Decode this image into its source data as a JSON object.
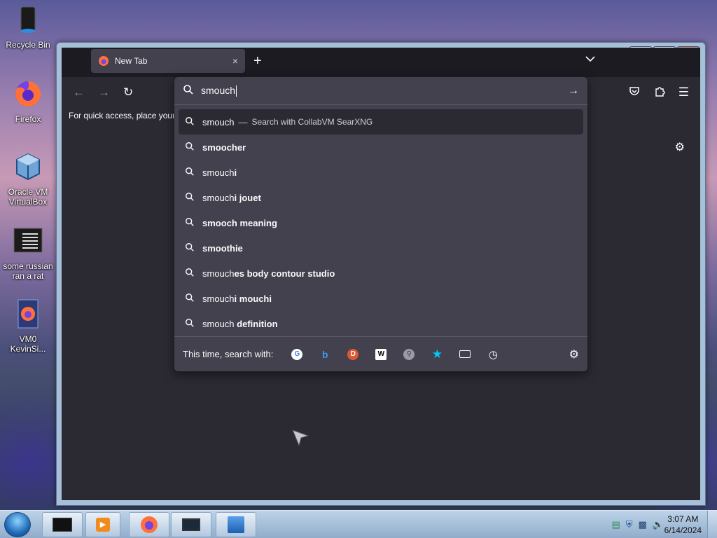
{
  "desktop": {
    "icons": [
      {
        "label": "Recycle Bin",
        "icon": "recycle-bin-icon"
      },
      {
        "label": "Firefox",
        "icon": "firefox-icon"
      },
      {
        "label": "Oracle VM VirtualBox",
        "icon": "virtualbox-icon"
      },
      {
        "label": "some russian ran a rat",
        "icon": "text-file-icon"
      },
      {
        "label": "VM0 KevinSi...",
        "icon": "firefox-shortcut-icon"
      }
    ]
  },
  "browser": {
    "tab": {
      "title": "New Tab",
      "close": "×"
    },
    "new_tab": "+",
    "list_all_tabs": "⌄",
    "bookmarks_hint": "For quick access, place your",
    "urlbar": {
      "value": "smouch"
    },
    "suggestions": [
      {
        "normal": "smouch",
        "bold": "",
        "action": "Search with CollabVM SearXNG",
        "selected": true
      },
      {
        "normal": "",
        "bold": "smoocher"
      },
      {
        "normal": "smouch",
        "bold": "i"
      },
      {
        "normal": "smouch",
        "bold": "i jouet"
      },
      {
        "normal": "",
        "bold": "smooch meaning"
      },
      {
        "normal": "",
        "bold": "smoothie"
      },
      {
        "normal": "smouch",
        "bold": "es body contour studio"
      },
      {
        "normal": "smouch",
        "bold": "i mouchi"
      },
      {
        "normal": "smouch ",
        "bold": "definition"
      }
    ],
    "one_off_label": "This time, search with:",
    "engines": [
      "google",
      "bing",
      "duckduckgo",
      "wikipedia",
      "searxng",
      "bookmarks",
      "tabs",
      "history"
    ]
  },
  "taskbar": {
    "clock_time": "3:07 AM",
    "clock_date": "6/14/2024"
  },
  "colors": {
    "popup_bg": "#42414d",
    "toolbar_bg": "#2b2a33",
    "tabstrip_bg": "#1c1b22",
    "text": "#fbfbfe"
  }
}
